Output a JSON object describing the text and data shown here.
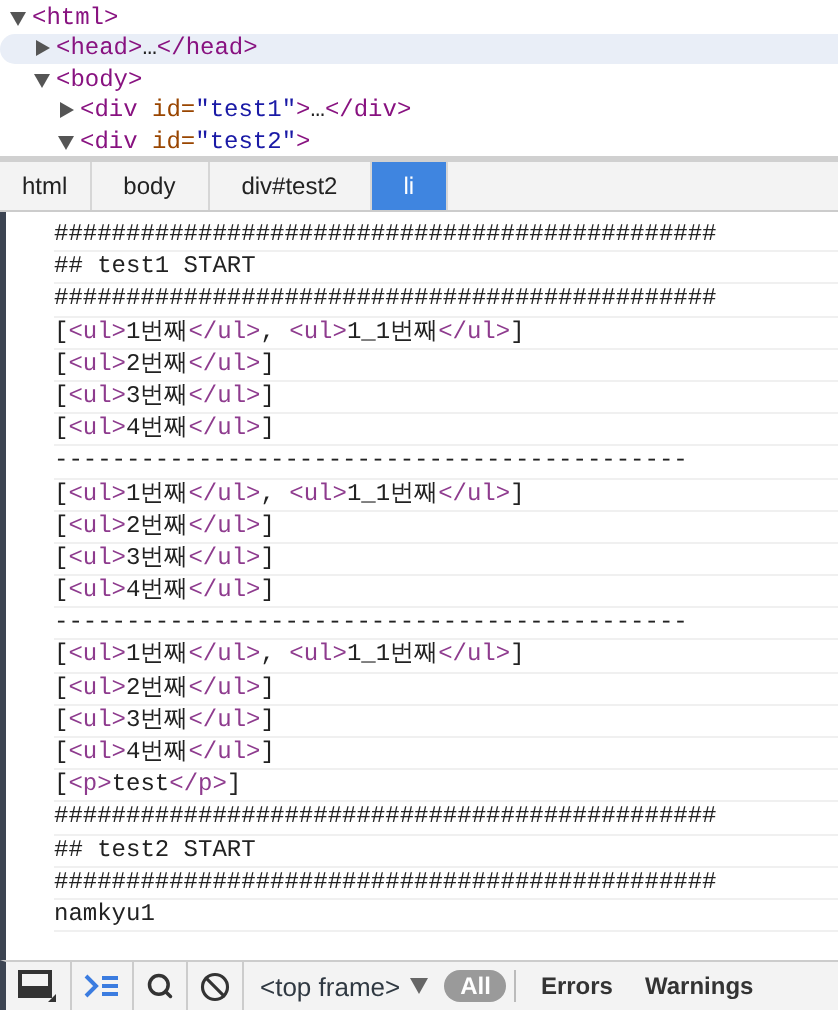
{
  "elements_tree": [
    {
      "label": "<html>",
      "expanded": true,
      "highlighted": false,
      "children": [
        {
          "label": "<head>…</head>",
          "expanded": false,
          "highlighted": true
        },
        {
          "label": "<body>",
          "expanded": true,
          "highlighted": false,
          "children": [
            {
              "label": "<div id=\"test1\">…</div>",
              "expanded": false,
              "highlighted": false
            },
            {
              "label": "<div id=\"test2\">",
              "expanded": true,
              "highlighted": false
            }
          ]
        }
      ]
    }
  ],
  "breadcrumbs": [
    {
      "label": "html",
      "selected": false
    },
    {
      "label": "body",
      "selected": false
    },
    {
      "label": "div#test2",
      "selected": false
    },
    {
      "label": "li",
      "selected": true
    }
  ],
  "console_lines": [
    "##############################################",
    "## test1 START",
    "##############################################",
    "[<ul>1번째</ul>, <ul>1_1번째</ul>]",
    "[<ul>2번째</ul>]",
    "[<ul>3번째</ul>]",
    "[<ul>4번째</ul>]",
    "--------------------------------------------",
    "[<ul>1번째</ul>, <ul>1_1번째</ul>]",
    "[<ul>2번째</ul>]",
    "[<ul>3번째</ul>]",
    "[<ul>4번째</ul>]",
    "--------------------------------------------",
    "[<ul>1번째</ul>, <ul>1_1번째</ul>]",
    "[<ul>2번째</ul>]",
    "[<ul>3번째</ul>]",
    "[<ul>4번째</ul>]",
    "[<p>test</p>]",
    "##############################################",
    "## test2 START",
    "##############################################",
    "namkyu1"
  ],
  "toolbar": {
    "frame_select": "<top frame>",
    "filters": [
      {
        "label": "All",
        "selected": true
      },
      {
        "label": "Errors",
        "selected": false
      },
      {
        "label": "Warnings",
        "selected": false
      }
    ]
  }
}
